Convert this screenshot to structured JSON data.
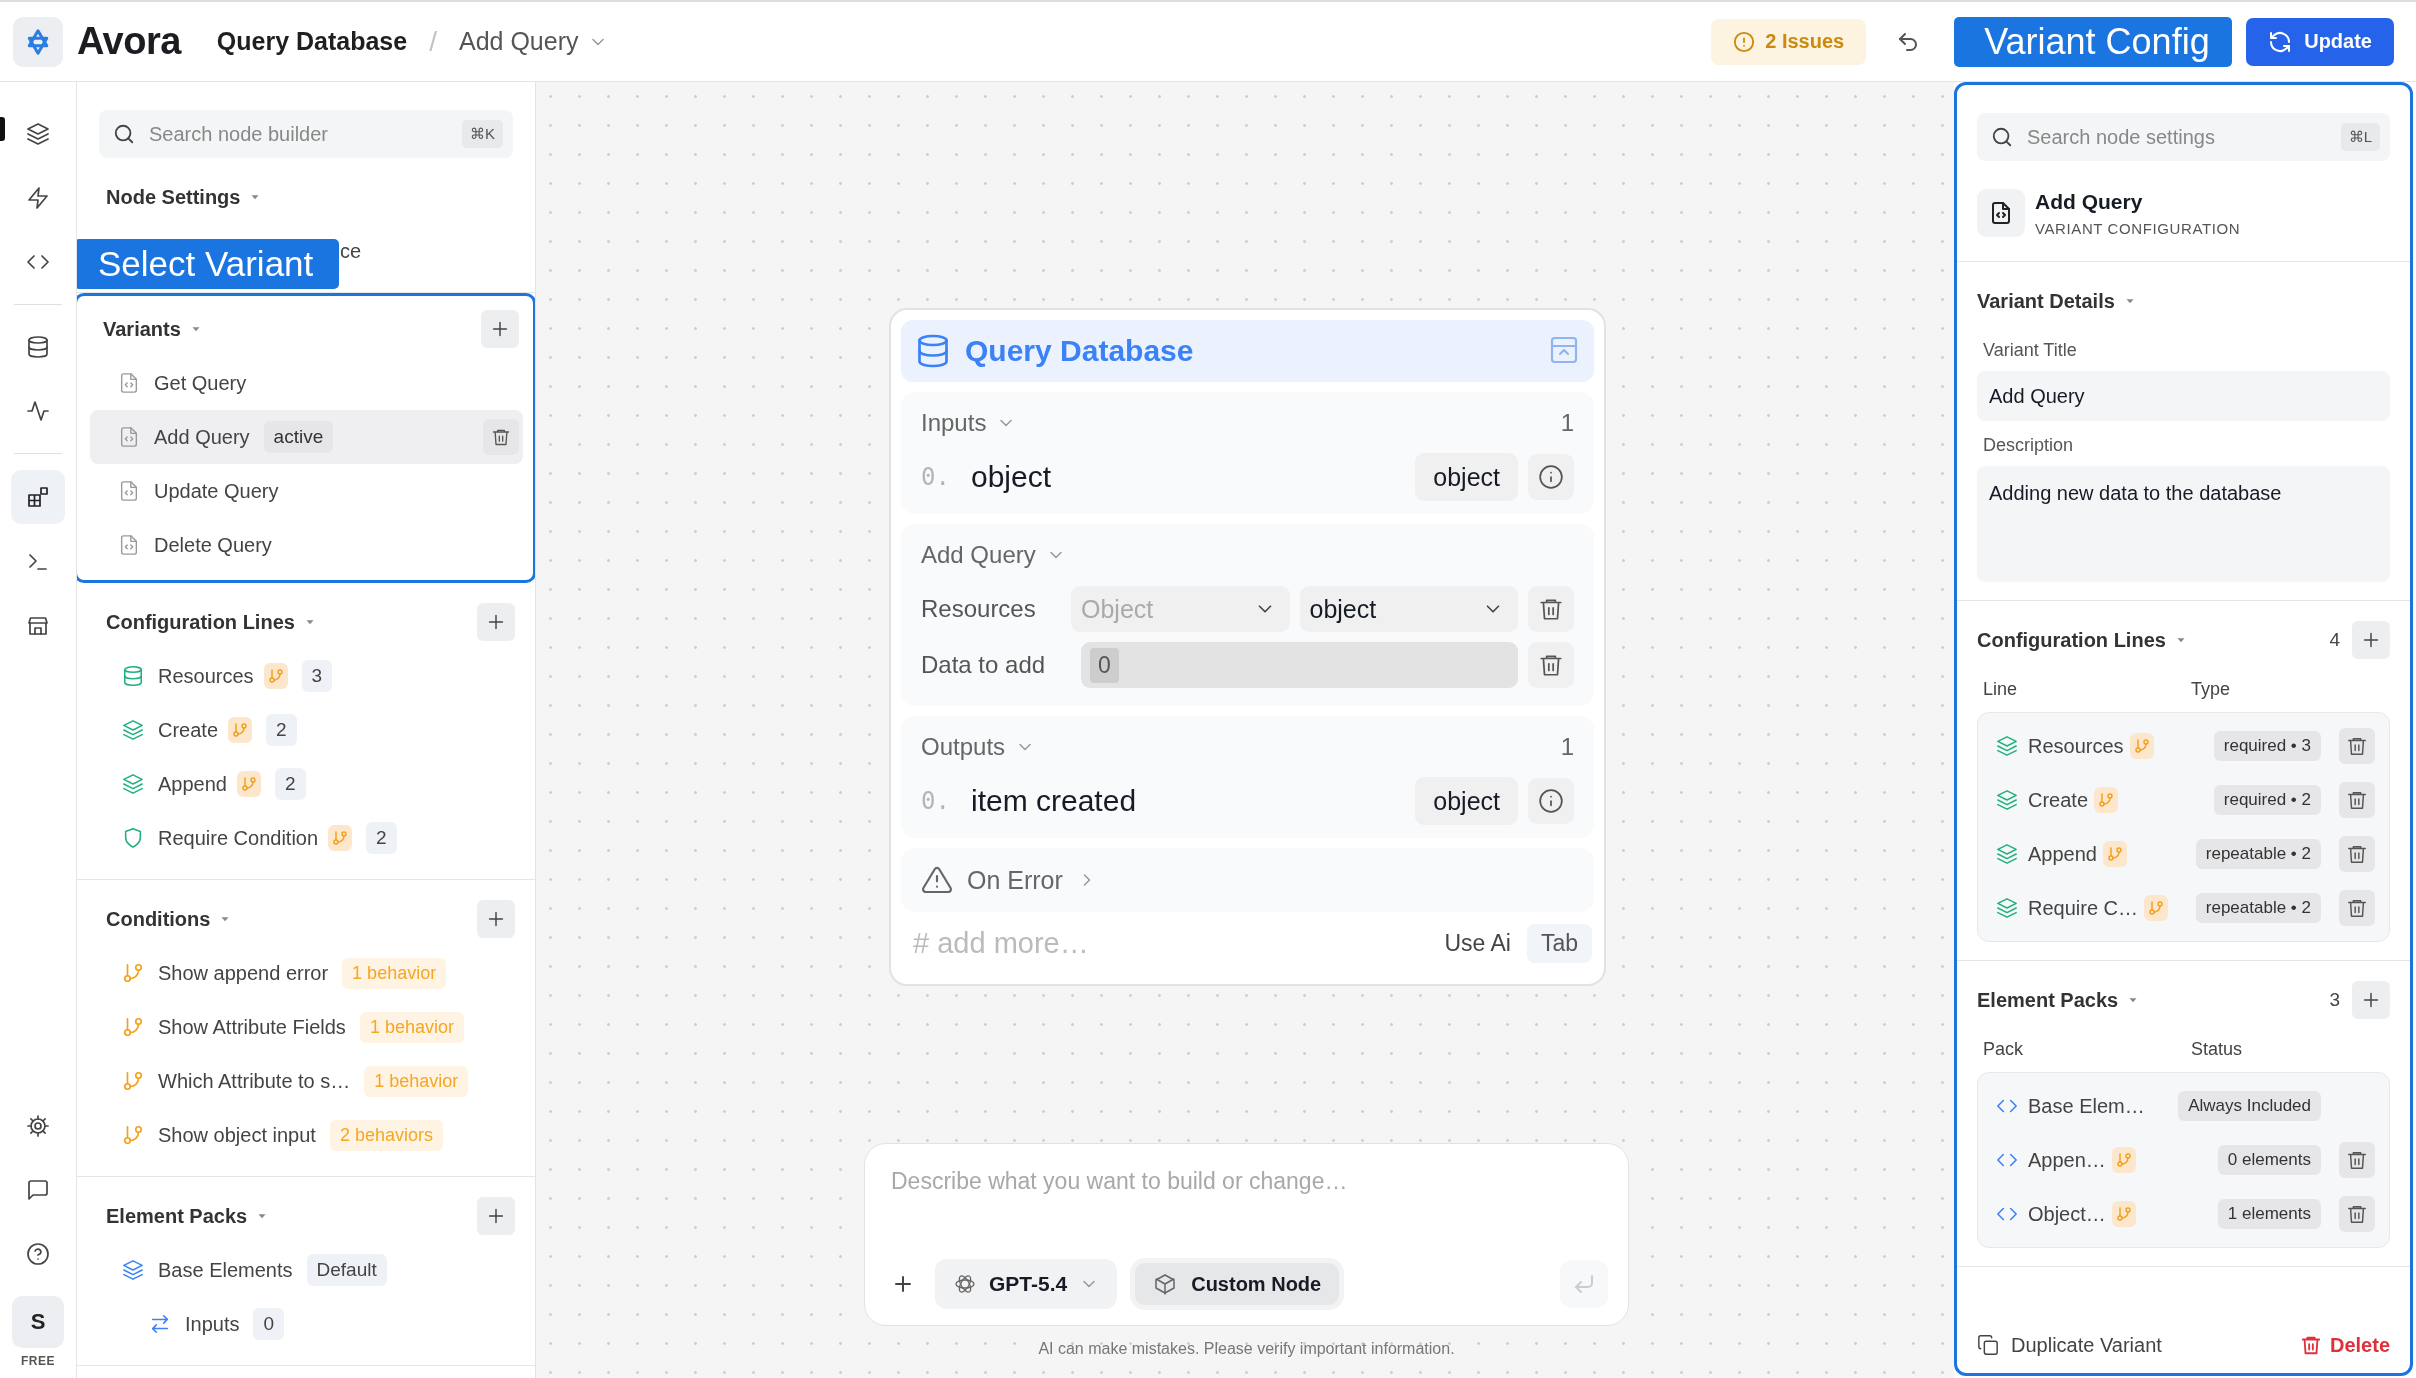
{
  "app": {
    "name": "Avora"
  },
  "breadcrumb": {
    "parent": "Query Database",
    "separator": "/",
    "current": "Add Query"
  },
  "toolbar": {
    "issues": "2 Issues",
    "annotation": "Variant Config",
    "update": "Update"
  },
  "rail": {
    "groups": [
      [
        {
          "kind": "layers",
          "selected": false
        },
        {
          "kind": "zap",
          "selected": false
        },
        {
          "kind": "code",
          "selected": false
        }
      ],
      [
        {
          "kind": "database",
          "selected": false
        },
        {
          "kind": "activity",
          "selected": false
        }
      ],
      [
        {
          "kind": "blocks",
          "selected": true
        },
        {
          "kind": "terminal",
          "selected": false
        },
        {
          "kind": "store",
          "selected": false
        }
      ]
    ],
    "bottom": [
      {
        "kind": "settings"
      },
      {
        "kind": "message"
      },
      {
        "kind": "help"
      }
    ],
    "avatar": "S",
    "plan": "FREE"
  },
  "sidebar": {
    "annotation": "Select Variant",
    "search": {
      "placeholder": "Search node builder",
      "shortcut": "⌘K"
    },
    "sections": [
      {
        "kind": "settings",
        "title": "Node Settings",
        "items": [
          {
            "label": "ce"
          }
        ]
      },
      {
        "kind": "variants",
        "title": "Variants",
        "highlighted": true,
        "items": [
          {
            "label": "Get Query",
            "selected": false
          },
          {
            "label": "Add Query",
            "selected": true,
            "badge": "active"
          },
          {
            "label": "Update Query",
            "selected": false
          },
          {
            "label": "Delete Query",
            "selected": false
          }
        ]
      },
      {
        "kind": "lines",
        "title": "Configuration Lines",
        "items": [
          {
            "label": "Resources",
            "kind": "database",
            "branch": true,
            "count": "3"
          },
          {
            "label": "Create",
            "kind": "layers",
            "branch": true,
            "count": "2"
          },
          {
            "label": "Append",
            "kind": "layers",
            "branch": true,
            "count": "2"
          },
          {
            "label": "Require Condition",
            "kind": "shield",
            "branch": true,
            "count": "2"
          }
        ]
      },
      {
        "kind": "conditions",
        "title": "Conditions",
        "items": [
          {
            "label": "Show append error",
            "badge": "1 behavior"
          },
          {
            "label": "Show Attribute Fields",
            "badge": "1 behavior"
          },
          {
            "label": "Which Attribute to s…",
            "badge": "1 behavior"
          },
          {
            "label": "Show object input",
            "badge": "2 behaviors"
          }
        ]
      },
      {
        "kind": "packs",
        "title": "Element Packs",
        "items": [
          {
            "label": "Base Elements",
            "badge": "Default",
            "children": [
              {
                "label": "Inputs",
                "count": "0"
              }
            ]
          }
        ]
      }
    ]
  },
  "node": {
    "title": "Query Database",
    "inputs": {
      "title": "Inputs",
      "count": "1",
      "rows": [
        {
          "index": "0.",
          "name": "object",
          "type": "object"
        }
      ]
    },
    "query": {
      "title": "Add Query",
      "fields": [
        {
          "kind": "selects",
          "label": "Resources",
          "selects": [
            {
              "placeholder": "Object"
            },
            {
              "value": "object"
            }
          ]
        },
        {
          "kind": "chips",
          "label": "Data to add",
          "chips": [
            "0"
          ]
        }
      ]
    },
    "outputs": {
      "title": "Outputs",
      "count": "1",
      "rows": [
        {
          "index": "0.",
          "name": "item created",
          "type": "object"
        }
      ]
    },
    "on_error": "On Error",
    "footer": {
      "placeholder": "# add more…",
      "hint": "Use Ai",
      "key": "Tab"
    }
  },
  "chat": {
    "placeholder": "Describe what you want to build or change…",
    "model": "GPT-5.4",
    "mode": "Custom Node",
    "disclaimer": "AI can make mistakes. Please verify important information."
  },
  "panel": {
    "highlighted": true,
    "search": {
      "placeholder": "Search node settings",
      "shortcut": "⌘L"
    },
    "header": {
      "title": "Add Query",
      "subtitle": "VARIANT CONFIGURATION"
    },
    "details": {
      "title": "Variant Details",
      "fields": [
        {
          "kind": "input",
          "label": "Variant Title",
          "value": "Add Query"
        },
        {
          "kind": "textarea",
          "label": "Description",
          "value": "Adding new data to the database"
        }
      ]
    },
    "lines": {
      "title": "Configuration Lines",
      "count": "4",
      "columns": [
        "Line",
        "Type"
      ],
      "rows": [
        {
          "label": "Resources",
          "kind": "layers",
          "branch": true,
          "tag": "required • 3",
          "deletable": true
        },
        {
          "label": "Create",
          "kind": "layers",
          "branch": true,
          "tag": "required • 2",
          "deletable": true
        },
        {
          "label": "Append",
          "kind": "layers",
          "branch": true,
          "tag": "repeatable • 2",
          "deletable": true
        },
        {
          "label": "Require C…",
          "kind": "layers",
          "branch": true,
          "tag": "repeatable • 2",
          "deletable": true
        }
      ]
    },
    "packs": {
      "title": "Element Packs",
      "count": "3",
      "columns": [
        "Pack",
        "Status"
      ],
      "rows": [
        {
          "label": "Base Elem…",
          "kind": "code",
          "branch": false,
          "tag": "Always Included",
          "deletable": false
        },
        {
          "label": "Appen…",
          "kind": "code",
          "branch": true,
          "tag": "0 elements",
          "deletable": true
        },
        {
          "label": "Object…",
          "kind": "code",
          "branch": true,
          "tag": "1 elements",
          "deletable": true
        }
      ]
    },
    "footer": {
      "duplicate": "Duplicate Variant",
      "delete": "Delete"
    }
  }
}
